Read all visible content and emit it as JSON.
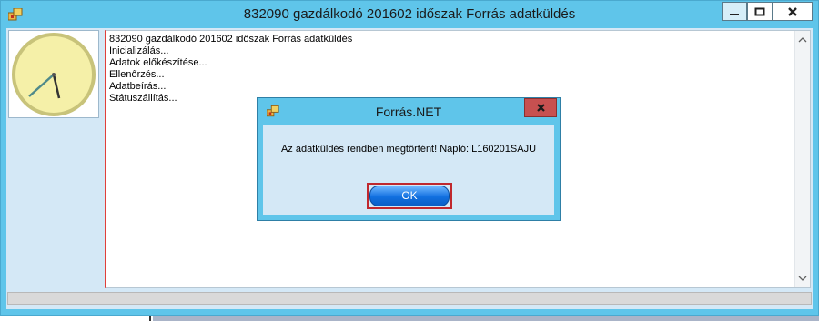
{
  "window": {
    "title": "832090 gazdálkodó 201602 időszak Forrás adatküldés",
    "icon": "app-icon"
  },
  "log": {
    "lines": [
      "832090 gazdálkodó 201602 időszak Forrás adatküldés",
      "Inicializálás...",
      "Adatok előkészítése...",
      "Ellenőrzés...",
      "Adatbeírás...",
      "Státuszállítás..."
    ]
  },
  "dialog": {
    "title": "Forrás.NET",
    "message": "Az adatküldés rendben megtörtént! Napló:IL160201SAJU",
    "ok_label": "OK"
  },
  "colors": {
    "titlebar": "#5fc5ea",
    "client": "#d4e8f6",
    "close_red": "#c75050",
    "ok_blue": "#1170e0"
  }
}
